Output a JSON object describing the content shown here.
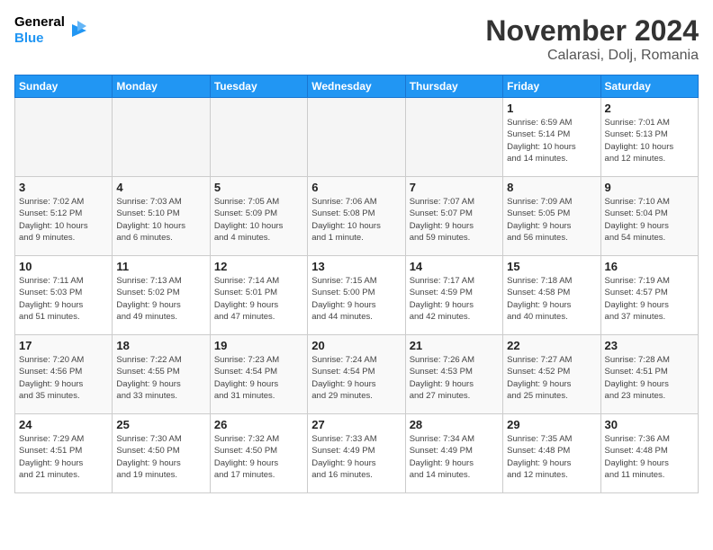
{
  "header": {
    "logo_line1": "General",
    "logo_line2": "Blue",
    "month_title": "November 2024",
    "location": "Calarasi, Dolj, Romania"
  },
  "weekdays": [
    "Sunday",
    "Monday",
    "Tuesday",
    "Wednesday",
    "Thursday",
    "Friday",
    "Saturday"
  ],
  "weeks": [
    [
      {
        "day": "",
        "info": ""
      },
      {
        "day": "",
        "info": ""
      },
      {
        "day": "",
        "info": ""
      },
      {
        "day": "",
        "info": ""
      },
      {
        "day": "",
        "info": ""
      },
      {
        "day": "1",
        "info": "Sunrise: 6:59 AM\nSunset: 5:14 PM\nDaylight: 10 hours\nand 14 minutes."
      },
      {
        "day": "2",
        "info": "Sunrise: 7:01 AM\nSunset: 5:13 PM\nDaylight: 10 hours\nand 12 minutes."
      }
    ],
    [
      {
        "day": "3",
        "info": "Sunrise: 7:02 AM\nSunset: 5:12 PM\nDaylight: 10 hours\nand 9 minutes."
      },
      {
        "day": "4",
        "info": "Sunrise: 7:03 AM\nSunset: 5:10 PM\nDaylight: 10 hours\nand 6 minutes."
      },
      {
        "day": "5",
        "info": "Sunrise: 7:05 AM\nSunset: 5:09 PM\nDaylight: 10 hours\nand 4 minutes."
      },
      {
        "day": "6",
        "info": "Sunrise: 7:06 AM\nSunset: 5:08 PM\nDaylight: 10 hours\nand 1 minute."
      },
      {
        "day": "7",
        "info": "Sunrise: 7:07 AM\nSunset: 5:07 PM\nDaylight: 9 hours\nand 59 minutes."
      },
      {
        "day": "8",
        "info": "Sunrise: 7:09 AM\nSunset: 5:05 PM\nDaylight: 9 hours\nand 56 minutes."
      },
      {
        "day": "9",
        "info": "Sunrise: 7:10 AM\nSunset: 5:04 PM\nDaylight: 9 hours\nand 54 minutes."
      }
    ],
    [
      {
        "day": "10",
        "info": "Sunrise: 7:11 AM\nSunset: 5:03 PM\nDaylight: 9 hours\nand 51 minutes."
      },
      {
        "day": "11",
        "info": "Sunrise: 7:13 AM\nSunset: 5:02 PM\nDaylight: 9 hours\nand 49 minutes."
      },
      {
        "day": "12",
        "info": "Sunrise: 7:14 AM\nSunset: 5:01 PM\nDaylight: 9 hours\nand 47 minutes."
      },
      {
        "day": "13",
        "info": "Sunrise: 7:15 AM\nSunset: 5:00 PM\nDaylight: 9 hours\nand 44 minutes."
      },
      {
        "day": "14",
        "info": "Sunrise: 7:17 AM\nSunset: 4:59 PM\nDaylight: 9 hours\nand 42 minutes."
      },
      {
        "day": "15",
        "info": "Sunrise: 7:18 AM\nSunset: 4:58 PM\nDaylight: 9 hours\nand 40 minutes."
      },
      {
        "day": "16",
        "info": "Sunrise: 7:19 AM\nSunset: 4:57 PM\nDaylight: 9 hours\nand 37 minutes."
      }
    ],
    [
      {
        "day": "17",
        "info": "Sunrise: 7:20 AM\nSunset: 4:56 PM\nDaylight: 9 hours\nand 35 minutes."
      },
      {
        "day": "18",
        "info": "Sunrise: 7:22 AM\nSunset: 4:55 PM\nDaylight: 9 hours\nand 33 minutes."
      },
      {
        "day": "19",
        "info": "Sunrise: 7:23 AM\nSunset: 4:54 PM\nDaylight: 9 hours\nand 31 minutes."
      },
      {
        "day": "20",
        "info": "Sunrise: 7:24 AM\nSunset: 4:54 PM\nDaylight: 9 hours\nand 29 minutes."
      },
      {
        "day": "21",
        "info": "Sunrise: 7:26 AM\nSunset: 4:53 PM\nDaylight: 9 hours\nand 27 minutes."
      },
      {
        "day": "22",
        "info": "Sunrise: 7:27 AM\nSunset: 4:52 PM\nDaylight: 9 hours\nand 25 minutes."
      },
      {
        "day": "23",
        "info": "Sunrise: 7:28 AM\nSunset: 4:51 PM\nDaylight: 9 hours\nand 23 minutes."
      }
    ],
    [
      {
        "day": "24",
        "info": "Sunrise: 7:29 AM\nSunset: 4:51 PM\nDaylight: 9 hours\nand 21 minutes."
      },
      {
        "day": "25",
        "info": "Sunrise: 7:30 AM\nSunset: 4:50 PM\nDaylight: 9 hours\nand 19 minutes."
      },
      {
        "day": "26",
        "info": "Sunrise: 7:32 AM\nSunset: 4:50 PM\nDaylight: 9 hours\nand 17 minutes."
      },
      {
        "day": "27",
        "info": "Sunrise: 7:33 AM\nSunset: 4:49 PM\nDaylight: 9 hours\nand 16 minutes."
      },
      {
        "day": "28",
        "info": "Sunrise: 7:34 AM\nSunset: 4:49 PM\nDaylight: 9 hours\nand 14 minutes."
      },
      {
        "day": "29",
        "info": "Sunrise: 7:35 AM\nSunset: 4:48 PM\nDaylight: 9 hours\nand 12 minutes."
      },
      {
        "day": "30",
        "info": "Sunrise: 7:36 AM\nSunset: 4:48 PM\nDaylight: 9 hours\nand 11 minutes."
      }
    ]
  ]
}
